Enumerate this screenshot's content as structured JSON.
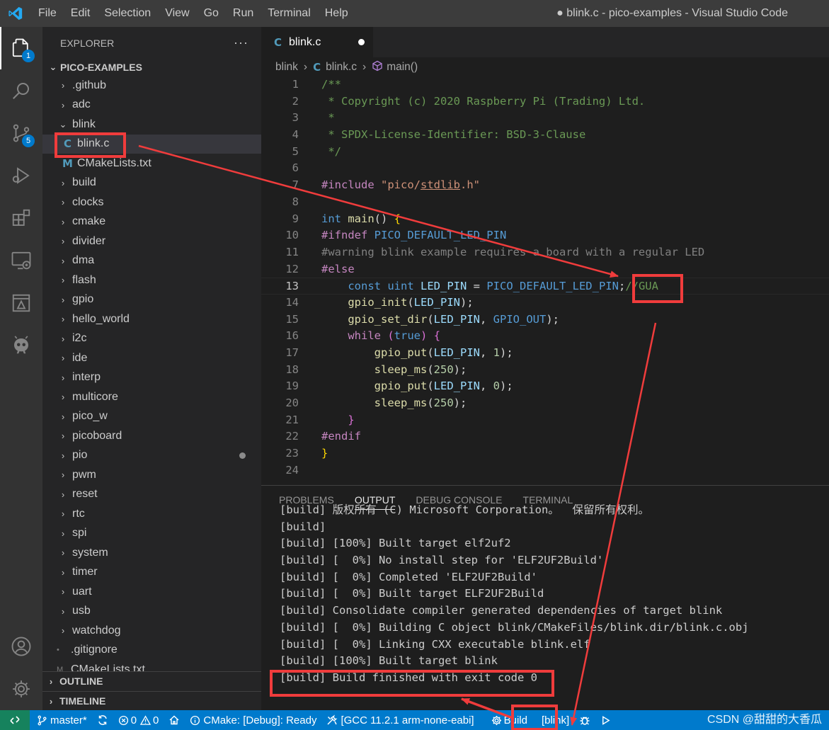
{
  "titlebar": {
    "menu": [
      "File",
      "Edit",
      "Selection",
      "View",
      "Go",
      "Run",
      "Terminal",
      "Help"
    ],
    "window_title": "● blink.c - pico-examples - Visual Studio Code"
  },
  "activity_bar": {
    "items": [
      {
        "name": "explorer-icon",
        "badge": "1"
      },
      {
        "name": "search-icon",
        "badge": ""
      },
      {
        "name": "source-control-icon",
        "badge": "5"
      },
      {
        "name": "run-debug-icon",
        "badge": ""
      },
      {
        "name": "extensions-icon",
        "badge": ""
      },
      {
        "name": "remote-explorer-icon",
        "badge": ""
      },
      {
        "name": "cmake-icon",
        "badge": ""
      },
      {
        "name": "platformio-icon",
        "badge": ""
      }
    ],
    "bottom": [
      "accounts-icon",
      "manage-gear-icon"
    ]
  },
  "sidebar": {
    "title": "EXPLORER",
    "more": "···",
    "workspace": "PICO-EXAMPLES",
    "tree": [
      {
        "label": ".github",
        "depth": 1,
        "kind": "folder"
      },
      {
        "label": "adc",
        "depth": 1,
        "kind": "folder"
      },
      {
        "label": "blink",
        "depth": 1,
        "kind": "folder-open"
      },
      {
        "label": "blink.c",
        "depth": 2,
        "kind": "c",
        "selected": true
      },
      {
        "label": "CMakeLists.txt",
        "depth": 2,
        "kind": "cmake"
      },
      {
        "label": "build",
        "depth": 1,
        "kind": "folder"
      },
      {
        "label": "clocks",
        "depth": 1,
        "kind": "folder"
      },
      {
        "label": "cmake",
        "depth": 1,
        "kind": "folder"
      },
      {
        "label": "divider",
        "depth": 1,
        "kind": "folder"
      },
      {
        "label": "dma",
        "depth": 1,
        "kind": "folder"
      },
      {
        "label": "flash",
        "depth": 1,
        "kind": "folder"
      },
      {
        "label": "gpio",
        "depth": 1,
        "kind": "folder"
      },
      {
        "label": "hello_world",
        "depth": 1,
        "kind": "folder"
      },
      {
        "label": "i2c",
        "depth": 1,
        "kind": "folder"
      },
      {
        "label": "ide",
        "depth": 1,
        "kind": "folder"
      },
      {
        "label": "interp",
        "depth": 1,
        "kind": "folder"
      },
      {
        "label": "multicore",
        "depth": 1,
        "kind": "folder"
      },
      {
        "label": "pico_w",
        "depth": 1,
        "kind": "folder"
      },
      {
        "label": "picoboard",
        "depth": 1,
        "kind": "folder"
      },
      {
        "label": "pio",
        "depth": 1,
        "kind": "folder",
        "modified": true
      },
      {
        "label": "pwm",
        "depth": 1,
        "kind": "folder"
      },
      {
        "label": "reset",
        "depth": 1,
        "kind": "folder"
      },
      {
        "label": "rtc",
        "depth": 1,
        "kind": "folder"
      },
      {
        "label": "spi",
        "depth": 1,
        "kind": "folder"
      },
      {
        "label": "system",
        "depth": 1,
        "kind": "folder"
      },
      {
        "label": "timer",
        "depth": 1,
        "kind": "folder"
      },
      {
        "label": "uart",
        "depth": 1,
        "kind": "folder"
      },
      {
        "label": "usb",
        "depth": 1,
        "kind": "folder"
      },
      {
        "label": "watchdog",
        "depth": 1,
        "kind": "folder"
      },
      {
        "label": ".gitignore",
        "depth": 1,
        "kind": "file"
      },
      {
        "label": "CMakeLists.txt",
        "depth": 1,
        "kind": "file"
      }
    ],
    "outline": "OUTLINE",
    "timeline": "TIMELINE"
  },
  "editor": {
    "tab": {
      "icon": "C",
      "label": "blink.c"
    },
    "breadcrumb": {
      "folder": "blink",
      "file": "blink.c",
      "symbol": "main()"
    },
    "current_line": 13,
    "lines": [
      [
        [
          "c-com",
          "/**"
        ]
      ],
      [
        [
          "c-com",
          " * Copyright (c) 2020 Raspberry Pi (Trading) Ltd."
        ]
      ],
      [
        [
          "c-com",
          " *"
        ]
      ],
      [
        [
          "c-com",
          " * SPDX-License-Identifier: BSD-3-Clause"
        ]
      ],
      [
        [
          "c-com",
          " */"
        ]
      ],
      [],
      [
        [
          "c-ctl",
          "#include "
        ],
        [
          "c-str",
          "\"pico/"
        ],
        [
          "c-str uline",
          "stdlib"
        ],
        [
          "c-str",
          ".h\""
        ]
      ],
      [],
      [
        [
          "c-kw",
          "int "
        ],
        [
          "c-fn",
          "main"
        ],
        [
          "",
          "() "
        ],
        [
          "c-br",
          "{"
        ]
      ],
      [
        [
          "c-ctl",
          "#ifndef "
        ],
        [
          "c-mac",
          "PICO_DEFAULT_LED_PIN"
        ]
      ],
      [
        [
          "c-dis",
          "#warning blink example requires a board with a regular LED"
        ]
      ],
      [
        [
          "c-ctl",
          "#else"
        ]
      ],
      [
        [
          "",
          "    "
        ],
        [
          "c-kw",
          "const "
        ],
        [
          "c-kw",
          "uint "
        ],
        [
          "c-var",
          "LED_PIN"
        ],
        [
          "",
          " = "
        ],
        [
          "c-mac",
          "PICO_DEFAULT_LED_PIN"
        ],
        [
          "",
          ";"
        ],
        [
          "c-com",
          "//GUA"
        ]
      ],
      [
        [
          "",
          "    "
        ],
        [
          "c-fn",
          "gpio_init"
        ],
        [
          "",
          "("
        ],
        [
          "c-var",
          "LED_PIN"
        ],
        [
          "",
          ");"
        ]
      ],
      [
        [
          "",
          "    "
        ],
        [
          "c-fn",
          "gpio_set_dir"
        ],
        [
          "",
          "("
        ],
        [
          "c-var",
          "LED_PIN"
        ],
        [
          "",
          ", "
        ],
        [
          "c-mac",
          "GPIO_OUT"
        ],
        [
          "",
          ");"
        ]
      ],
      [
        [
          "",
          "    "
        ],
        [
          "c-ctl",
          "while "
        ],
        [
          "c-br2",
          "("
        ],
        [
          "c-kw",
          "true"
        ],
        [
          "c-br2",
          ")"
        ],
        [
          "",
          " "
        ],
        [
          "c-br2",
          "{"
        ]
      ],
      [
        [
          "",
          "        "
        ],
        [
          "c-fn",
          "gpio_put"
        ],
        [
          "",
          "("
        ],
        [
          "c-var",
          "LED_PIN"
        ],
        [
          "",
          ", "
        ],
        [
          "c-num",
          "1"
        ],
        [
          "",
          ");"
        ]
      ],
      [
        [
          "",
          "        "
        ],
        [
          "c-fn",
          "sleep_ms"
        ],
        [
          "",
          "("
        ],
        [
          "c-num",
          "250"
        ],
        [
          "",
          ");"
        ]
      ],
      [
        [
          "",
          "        "
        ],
        [
          "c-fn",
          "gpio_put"
        ],
        [
          "",
          "("
        ],
        [
          "c-var",
          "LED_PIN"
        ],
        [
          "",
          ", "
        ],
        [
          "c-num",
          "0"
        ],
        [
          "",
          ");"
        ]
      ],
      [
        [
          "",
          "        "
        ],
        [
          "c-fn",
          "sleep_ms"
        ],
        [
          "",
          "("
        ],
        [
          "c-num",
          "250"
        ],
        [
          "",
          ");"
        ]
      ],
      [
        [
          "",
          "    "
        ],
        [
          "c-br2",
          "}"
        ]
      ],
      [
        [
          "c-ctl",
          "#endif"
        ]
      ],
      [
        [
          "c-br",
          "}"
        ]
      ],
      []
    ]
  },
  "panel": {
    "tabs": [
      "PROBLEMS",
      "OUTPUT",
      "DEBUG CONSOLE",
      "TERMINAL"
    ],
    "active_tab": "OUTPUT",
    "output": [
      "[build] 版权所有 (C) Microsoft Corporation。  保留所有权利。",
      "[build]",
      "[build] [100%] Built target elf2uf2",
      "[build] [  0%] No install step for 'ELF2UF2Build'",
      "[build] [  0%] Completed 'ELF2UF2Build'",
      "[build] [  0%] Built target ELF2UF2Build",
      "[build] Consolidate compiler generated dependencies of target blink",
      "[build] [  0%] Building C object blink/CMakeFiles/blink.dir/blink.c.obj",
      "[build] [  0%] Linking CXX executable blink.elf",
      "[build] [100%] Built target blink",
      "[build] Build finished with exit code 0"
    ]
  },
  "statusbar": {
    "branch": "master*",
    "errors": "0",
    "warnings": "0",
    "cmake_status": "CMake: [Debug]: Ready",
    "kit": "[GCC 11.2.1 arm-none-eabi]",
    "build": "Build",
    "target": "[blink]",
    "watermark": "CSDN @甜甜的大香瓜"
  },
  "annotation": {
    "color": "#f03c3c"
  }
}
